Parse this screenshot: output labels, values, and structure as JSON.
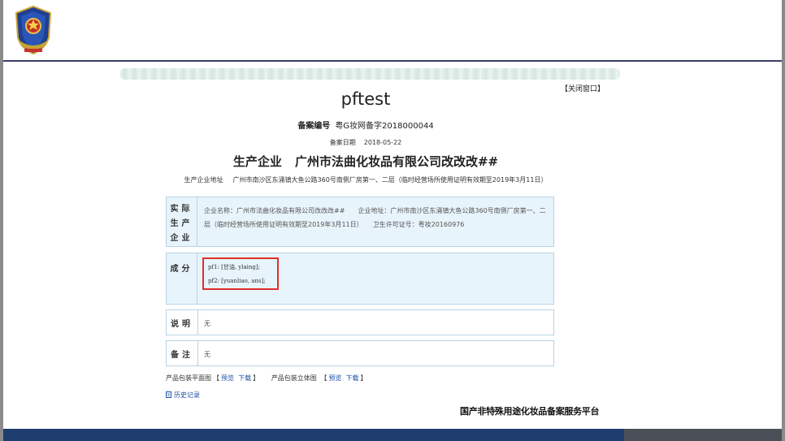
{
  "header": {
    "logo_icon": "police-emblem-icon"
  },
  "page": {
    "close_label": "【关闭窗口】",
    "title": "pftest",
    "record_no_label": "备案编号",
    "record_no_value": "粤G妆网备字2018000044",
    "record_date_label": "备案日期",
    "record_date_value": "2018-05-22",
    "producer_label": "生产企业",
    "producer_value": "广州市法曲化妆品有限公司改改改##",
    "address_label": "生产企业地址",
    "address_value": "广州市南沙区东涌镇大鱼公路360号南侧厂房第一、二层（临时经营场所使用证明有效期至2019年3月11日）"
  },
  "panels": {
    "enterprise": {
      "label_lines": [
        "实际",
        "生产",
        "企业"
      ],
      "line1": "企业名称：广州市法曲化妆品有限公司改改改##　　企业地址：广州市南沙区东涌镇大鱼公路360号南侧厂房第一、二",
      "line2": "层（临时经营场所使用证明有效期至2019年3月11日）　　卫生许可证号：粤妆20160976"
    },
    "ingredients": {
      "label": "成分",
      "items": [
        "pf1: [甘油, ylaing];",
        "pf2: [yuanliao, ans];"
      ]
    },
    "description": {
      "label": "说明",
      "value": "无"
    },
    "remarks": {
      "label": "备注",
      "value": "无"
    }
  },
  "packaging": {
    "flat_label": "产品包装平面图",
    "stereo_label": "产品包装立体图",
    "preview_label": "预览",
    "download_label": "下载",
    "bracket_open": "【",
    "bracket_close": "】"
  },
  "history_label": "历史记录",
  "history_icon": "history-doc-icon",
  "platform_name": "国产非特殊用途化妆品备案服务平台",
  "colors": {
    "accent_border": "#e0302a",
    "panel_bg": "#e8f4fb",
    "footer_bar": "#1e3d6e",
    "link": "#1a4fa3"
  }
}
